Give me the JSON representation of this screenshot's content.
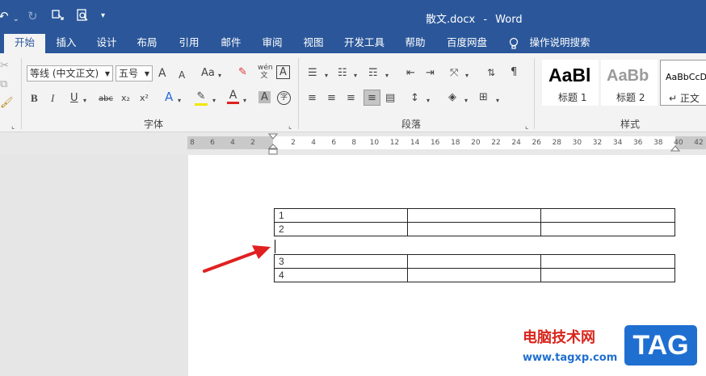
{
  "titlebar": {
    "document_title": "散文.docx",
    "separator": "-",
    "app_name": "Word"
  },
  "tabs": [
    "开始",
    "插入",
    "设计",
    "布局",
    "引用",
    "邮件",
    "审阅",
    "视图",
    "开发工具",
    "帮助",
    "百度网盘"
  ],
  "tell_me": "操作说明搜索",
  "font_group": {
    "font_name": "等线 (中文正文)",
    "font_size": "五号",
    "label": "字体",
    "grow_font": "A",
    "shrink_font": "A",
    "change_case": "Aa",
    "phonetic": "wén",
    "char_border": "A",
    "bold": "B",
    "italic": "I",
    "underline": "U",
    "strikethrough": "abc",
    "subscript": "x₂",
    "superscript": "x²",
    "text_effects": "A",
    "font_color": "A",
    "char_shading": "A",
    "enclose": "字"
  },
  "paragraph_group": {
    "label": "段落"
  },
  "styles_group": {
    "label": "样式",
    "items": [
      {
        "preview": "AaBl",
        "name": "标题 1"
      },
      {
        "preview": "AaBb",
        "name": "标题 2"
      },
      {
        "preview": "AaBbCcD",
        "name": "↵ 正文"
      }
    ]
  },
  "ruler": {
    "left_numbers": [
      "8",
      "6",
      "4",
      "2"
    ],
    "right_numbers": [
      "2",
      "4",
      "6",
      "8",
      "10",
      "12",
      "14",
      "16",
      "18",
      "20",
      "22",
      "24",
      "26",
      "28",
      "30",
      "32",
      "34",
      "36",
      "38",
      "40",
      "42"
    ]
  },
  "document_table": {
    "rows_top": [
      [
        "1",
        "",
        ""
      ],
      [
        "2",
        "",
        ""
      ]
    ],
    "rows_bottom": [
      [
        "3",
        "",
        ""
      ],
      [
        "4",
        "",
        ""
      ]
    ]
  },
  "watermark": {
    "text": "电脑技术网",
    "url": "www.tagxp.com",
    "logo": "TAG"
  },
  "colors": {
    "title_bar": "#2b579a",
    "arrow": "#e02020",
    "watermark_red": "#d9251c",
    "watermark_blue": "#1f6fd1"
  }
}
